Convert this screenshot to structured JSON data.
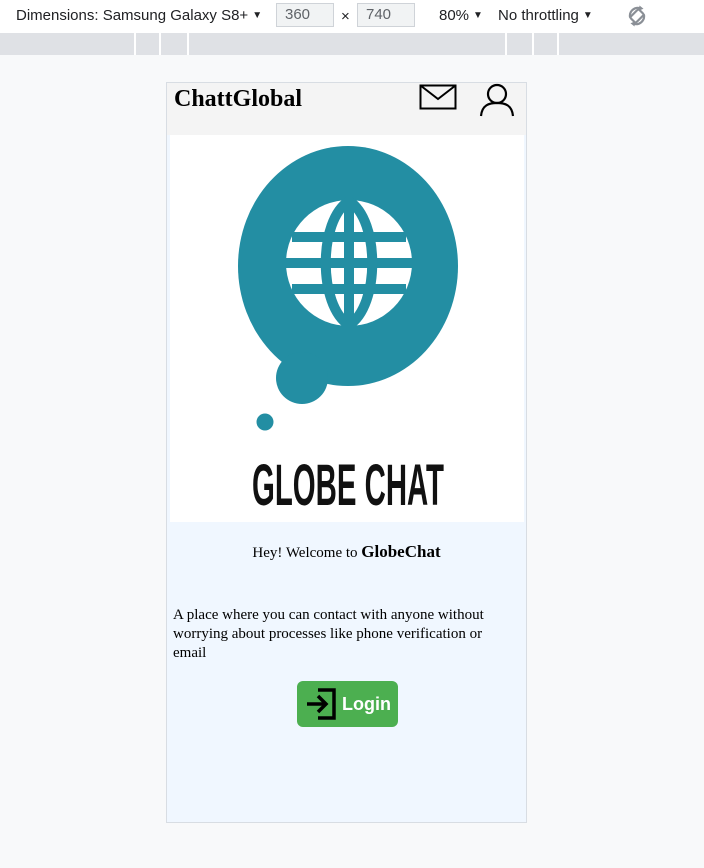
{
  "devtools": {
    "dimensions_label": "Dimensions: Samsung Galaxy S8+",
    "width": "360",
    "height": "740",
    "times": "×",
    "zoom": "80%",
    "throttling": "No throttling",
    "rotate_icon": "rotate-icon"
  },
  "app": {
    "brand": "ChattGlobal",
    "icons": [
      "mail-icon",
      "user-icon"
    ],
    "logo_text": "GLOBE CHAT",
    "welcome_prefix": "Hey! Welcome to ",
    "welcome_name": "GlobeChat",
    "description": "A place where you can contact with anyone without worrying about processes like phone verification or email",
    "login_label": "Login",
    "colors": {
      "logo_teal": "#238ea3",
      "login_green": "#4caf50",
      "page_background": "#f0f7ff",
      "header_background": "#f4f4f4"
    }
  }
}
